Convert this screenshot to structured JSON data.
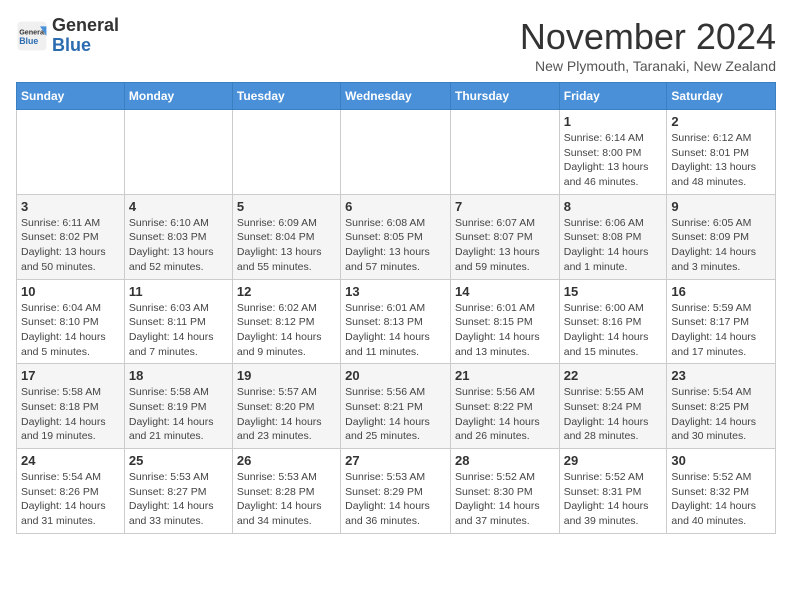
{
  "logo": {
    "general": "General",
    "blue": "Blue"
  },
  "title": "November 2024",
  "location": "New Plymouth, Taranaki, New Zealand",
  "headers": [
    "Sunday",
    "Monday",
    "Tuesday",
    "Wednesday",
    "Thursday",
    "Friday",
    "Saturday"
  ],
  "weeks": [
    [
      {
        "day": "",
        "info": ""
      },
      {
        "day": "",
        "info": ""
      },
      {
        "day": "",
        "info": ""
      },
      {
        "day": "",
        "info": ""
      },
      {
        "day": "",
        "info": ""
      },
      {
        "day": "1",
        "info": "Sunrise: 6:14 AM\nSunset: 8:00 PM\nDaylight: 13 hours and 46 minutes."
      },
      {
        "day": "2",
        "info": "Sunrise: 6:12 AM\nSunset: 8:01 PM\nDaylight: 13 hours and 48 minutes."
      }
    ],
    [
      {
        "day": "3",
        "info": "Sunrise: 6:11 AM\nSunset: 8:02 PM\nDaylight: 13 hours and 50 minutes."
      },
      {
        "day": "4",
        "info": "Sunrise: 6:10 AM\nSunset: 8:03 PM\nDaylight: 13 hours and 52 minutes."
      },
      {
        "day": "5",
        "info": "Sunrise: 6:09 AM\nSunset: 8:04 PM\nDaylight: 13 hours and 55 minutes."
      },
      {
        "day": "6",
        "info": "Sunrise: 6:08 AM\nSunset: 8:05 PM\nDaylight: 13 hours and 57 minutes."
      },
      {
        "day": "7",
        "info": "Sunrise: 6:07 AM\nSunset: 8:07 PM\nDaylight: 13 hours and 59 minutes."
      },
      {
        "day": "8",
        "info": "Sunrise: 6:06 AM\nSunset: 8:08 PM\nDaylight: 14 hours and 1 minute."
      },
      {
        "day": "9",
        "info": "Sunrise: 6:05 AM\nSunset: 8:09 PM\nDaylight: 14 hours and 3 minutes."
      }
    ],
    [
      {
        "day": "10",
        "info": "Sunrise: 6:04 AM\nSunset: 8:10 PM\nDaylight: 14 hours and 5 minutes."
      },
      {
        "day": "11",
        "info": "Sunrise: 6:03 AM\nSunset: 8:11 PM\nDaylight: 14 hours and 7 minutes."
      },
      {
        "day": "12",
        "info": "Sunrise: 6:02 AM\nSunset: 8:12 PM\nDaylight: 14 hours and 9 minutes."
      },
      {
        "day": "13",
        "info": "Sunrise: 6:01 AM\nSunset: 8:13 PM\nDaylight: 14 hours and 11 minutes."
      },
      {
        "day": "14",
        "info": "Sunrise: 6:01 AM\nSunset: 8:15 PM\nDaylight: 14 hours and 13 minutes."
      },
      {
        "day": "15",
        "info": "Sunrise: 6:00 AM\nSunset: 8:16 PM\nDaylight: 14 hours and 15 minutes."
      },
      {
        "day": "16",
        "info": "Sunrise: 5:59 AM\nSunset: 8:17 PM\nDaylight: 14 hours and 17 minutes."
      }
    ],
    [
      {
        "day": "17",
        "info": "Sunrise: 5:58 AM\nSunset: 8:18 PM\nDaylight: 14 hours and 19 minutes."
      },
      {
        "day": "18",
        "info": "Sunrise: 5:58 AM\nSunset: 8:19 PM\nDaylight: 14 hours and 21 minutes."
      },
      {
        "day": "19",
        "info": "Sunrise: 5:57 AM\nSunset: 8:20 PM\nDaylight: 14 hours and 23 minutes."
      },
      {
        "day": "20",
        "info": "Sunrise: 5:56 AM\nSunset: 8:21 PM\nDaylight: 14 hours and 25 minutes."
      },
      {
        "day": "21",
        "info": "Sunrise: 5:56 AM\nSunset: 8:22 PM\nDaylight: 14 hours and 26 minutes."
      },
      {
        "day": "22",
        "info": "Sunrise: 5:55 AM\nSunset: 8:24 PM\nDaylight: 14 hours and 28 minutes."
      },
      {
        "day": "23",
        "info": "Sunrise: 5:54 AM\nSunset: 8:25 PM\nDaylight: 14 hours and 30 minutes."
      }
    ],
    [
      {
        "day": "24",
        "info": "Sunrise: 5:54 AM\nSunset: 8:26 PM\nDaylight: 14 hours and 31 minutes."
      },
      {
        "day": "25",
        "info": "Sunrise: 5:53 AM\nSunset: 8:27 PM\nDaylight: 14 hours and 33 minutes."
      },
      {
        "day": "26",
        "info": "Sunrise: 5:53 AM\nSunset: 8:28 PM\nDaylight: 14 hours and 34 minutes."
      },
      {
        "day": "27",
        "info": "Sunrise: 5:53 AM\nSunset: 8:29 PM\nDaylight: 14 hours and 36 minutes."
      },
      {
        "day": "28",
        "info": "Sunrise: 5:52 AM\nSunset: 8:30 PM\nDaylight: 14 hours and 37 minutes."
      },
      {
        "day": "29",
        "info": "Sunrise: 5:52 AM\nSunset: 8:31 PM\nDaylight: 14 hours and 39 minutes."
      },
      {
        "day": "30",
        "info": "Sunrise: 5:52 AM\nSunset: 8:32 PM\nDaylight: 14 hours and 40 minutes."
      }
    ]
  ]
}
